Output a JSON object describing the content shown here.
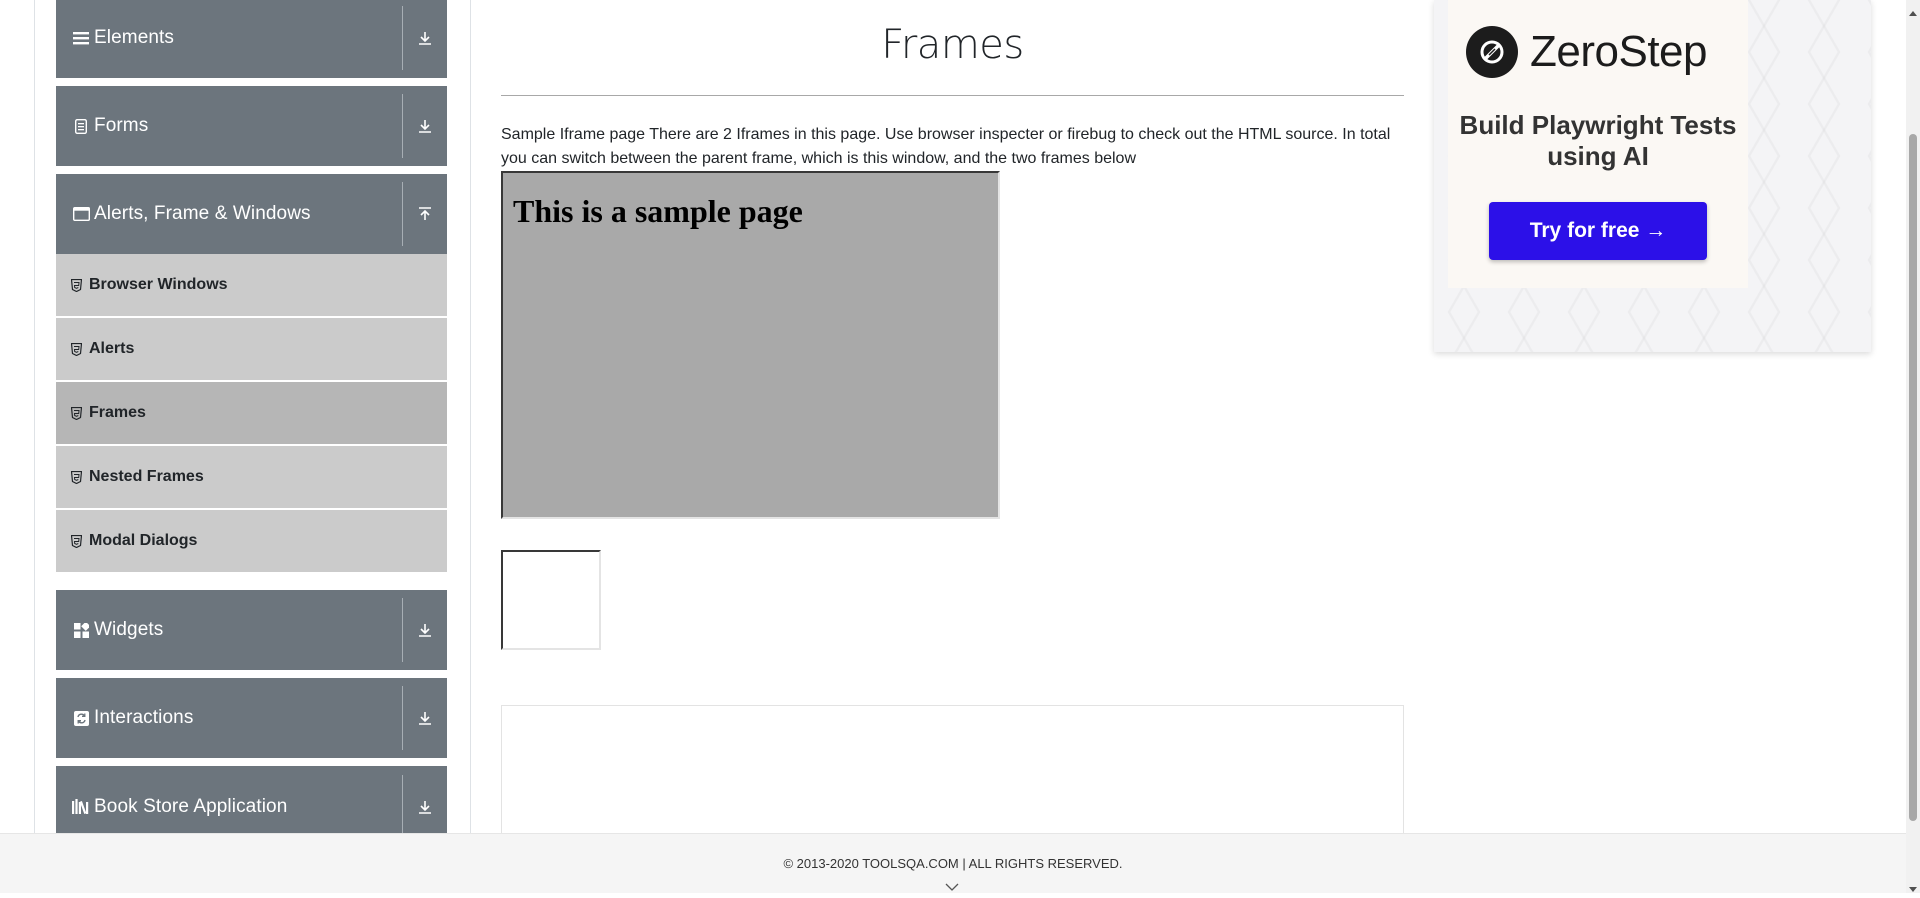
{
  "sidebar": {
    "groups": [
      {
        "label": "Elements",
        "icon": "hamburger-icon",
        "state": "collapsed"
      },
      {
        "label": "Forms",
        "icon": "form-icon",
        "state": "collapsed"
      },
      {
        "label": "Alerts, Frame & Windows",
        "icon": "window-icon",
        "state": "expanded"
      },
      {
        "label": "Widgets",
        "icon": "widgets-icon",
        "state": "collapsed"
      },
      {
        "label": "Interactions",
        "icon": "interactions-icon",
        "state": "collapsed"
      },
      {
        "label": "Book Store Application",
        "icon": "books-icon",
        "state": "collapsed"
      }
    ],
    "submenu": [
      {
        "label": "Browser Windows"
      },
      {
        "label": "Alerts"
      },
      {
        "label": "Frames",
        "active": true
      },
      {
        "label": "Nested Frames"
      },
      {
        "label": "Modal Dialogs"
      }
    ]
  },
  "main": {
    "title": "Frames",
    "description": "Sample Iframe page There are 2 Iframes in this page. Use browser inspecter or firebug to check out the HTML source. In total you can switch between the parent frame, which is this window, and the two frames below",
    "frame1_heading": "This is a sample page"
  },
  "ad": {
    "brand": "ZeroStep",
    "headline": "Build Playwright Tests using AI",
    "cta": "Try for free →",
    "cta_color": "#2c10e8"
  },
  "footer": {
    "copyright": "© 2013-2020 TOOLSQA.COM | ALL RIGHTS RESERVED."
  },
  "colors": {
    "group_header_bg": "#6c757d",
    "submenu_bg": "#cbcbcb",
    "submenu_active_bg": "#b6b6b6",
    "frame_bg": "#a9a9a9"
  }
}
